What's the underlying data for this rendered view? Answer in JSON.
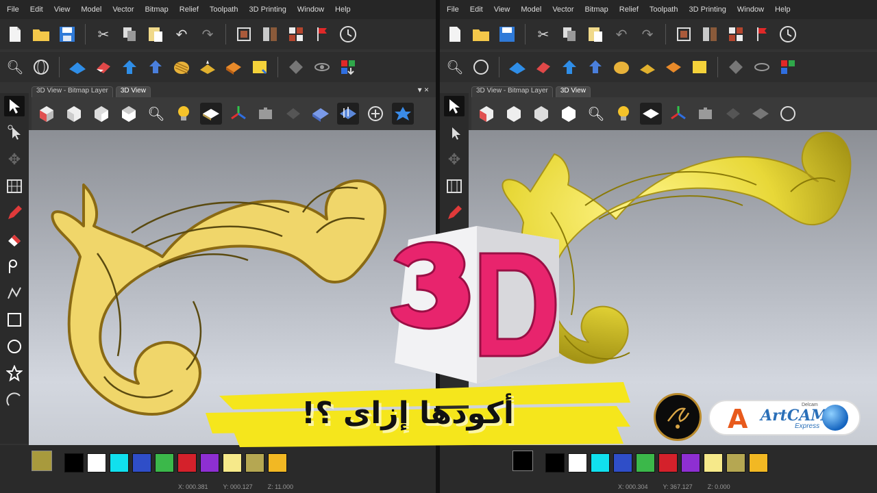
{
  "menu": [
    "File",
    "Edit",
    "View",
    "Model",
    "Vector",
    "Bitmap",
    "Relief",
    "Toolpath",
    "3D Printing",
    "Window",
    "Help"
  ],
  "tabs_left": [
    {
      "label": "3D View - Bitmap Layer",
      "active": false
    },
    {
      "label": "3D View",
      "active": true
    }
  ],
  "tabs_right": [
    {
      "label": "3D View - Bitmap Layer",
      "active": false
    },
    {
      "label": "3D View",
      "active": true
    }
  ],
  "tab_close_glyph": "▾ ×",
  "toolbar1_icons": [
    "new-file",
    "open-folder",
    "save",
    "cut",
    "copy",
    "paste",
    "undo",
    "redo",
    "layers",
    "toggle",
    "grid",
    "flag",
    "clock"
  ],
  "toolbar2_icons": [
    "zoom",
    "globe",
    "relief",
    "eraser",
    "arrow-up",
    "arrows",
    "texture",
    "sparkle",
    "box",
    "note",
    "diamond",
    "eye",
    "colors"
  ],
  "view_icons": [
    "iso-view",
    "front-view",
    "side-view",
    "top-view",
    "zoom",
    "light-bulb",
    "shade",
    "axes",
    "puzzle",
    "relief-shade",
    "relief-mesh",
    "blue-star",
    "rotate"
  ],
  "left_tools": [
    "select",
    "node-edit",
    "transform",
    "array",
    "pencil",
    "eraser",
    "measure",
    "polyline",
    "rectangle",
    "ellipse",
    "star",
    "arc"
  ],
  "palette": [
    "#000000",
    "#ffffff",
    "#11e0ee",
    "#2f4ec8",
    "#3bb84a",
    "#d4212b",
    "#8e2fd2",
    "#f6e98a",
    "#b5a752",
    "#f2b823"
  ],
  "current_colour_left": "#a89a3d",
  "current_colour_right": "#000000",
  "status_left": [
    "X: 000.381",
    "Y: 000.127",
    "Z: 11.000"
  ],
  "status_right": [
    "X: 000.304",
    "Y: 367.127",
    "Z: 0.000"
  ],
  "headline": "3D",
  "arabic_title": "أكودها إزاى ؟!",
  "badge": {
    "name": "Artcam Express",
    "sub": "Express",
    "small": "Delcam",
    "letter": "A",
    "art": "ArtCAM"
  },
  "colors": {
    "accent_pink": "#e8246d",
    "banner_yellow": "#f5e61c",
    "gold_relief": "#f0d66a",
    "gold_render": "#e8d838"
  }
}
